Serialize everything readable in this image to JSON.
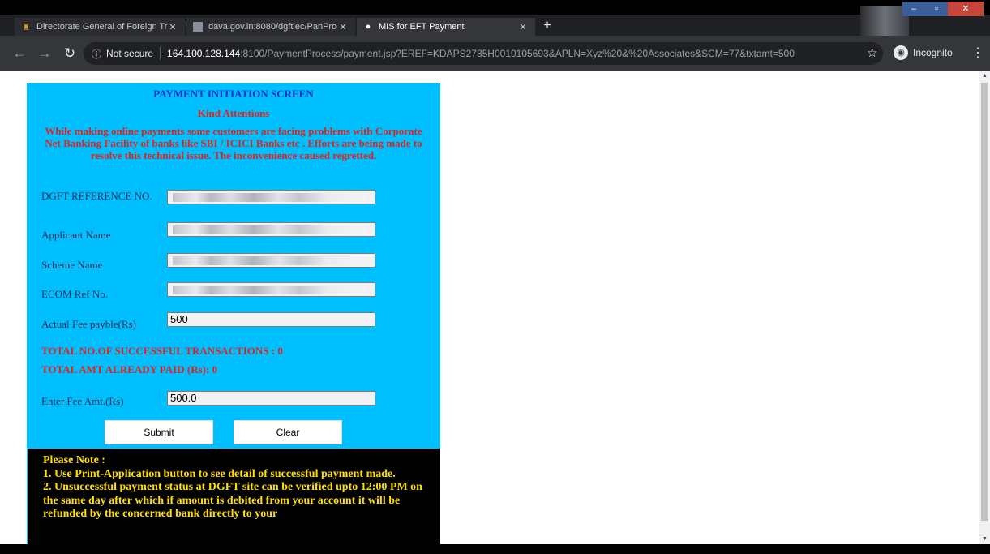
{
  "browser": {
    "tabs": [
      {
        "title": "Directorate General of Foreign Tr",
        "favicon": "emblem-icon",
        "active": false
      },
      {
        "title": "dava.gov.in:8080/dgftiec/PanProc",
        "favicon": "page-icon",
        "active": false
      },
      {
        "title": "MIS for EFT Payment",
        "favicon": "globe-icon",
        "active": true
      }
    ],
    "new_tab_symbol": "+",
    "security_label": "Not secure",
    "url_host": "164.100.128.144",
    "url_rest": ":8100/PaymentProcess/payment.jsp?EREF=KDAPS2735H0010105693&APLN=Xyz%20&%20Associates&SCM=77&txtamt=500",
    "profile_label": "Incognito"
  },
  "page": {
    "title": "PAYMENT INITIATION SCREEN",
    "attention_heading": "Kind Attentions",
    "attention_text": "While making online payments some customers are facing problems with Corporate Net Banking Facility of banks like SBI / ICICI Banks etc . Efforts are being made to resolve this technical issue. The inconvenience caused regretted.",
    "fields": {
      "dgft_ref_label": "DGFT REFERENCE NO.",
      "applicant_label": "Applicant Name",
      "scheme_label": "Scheme Name",
      "ecom_label": "ECOM Ref No.",
      "fee_label": "Actual Fee payble(Rs)",
      "fee_value": "500",
      "enter_fee_label": "Enter Fee Amt.(Rs)",
      "enter_fee_value": "500.0"
    },
    "total_transactions": "TOTAL NO.OF SUCCESSFUL TRANSACTIONS : 0",
    "total_paid": "TOTAL AMT ALREADY PAID (Rs): 0",
    "submit_label": "Submit",
    "clear_label": "Clear",
    "note": {
      "heading": "Please Note :",
      "line1": "1. Use Print-Application button to see detail of successful payment made.",
      "line2": "2. Unsuccessful payment status at DGFT site can be verified upto 12:00 PM on the same day after which if amount is debited from your account it will be refunded by the concerned bank directly to your"
    }
  },
  "colors": {
    "panel_bg": "#00bfff",
    "title_blue": "#0033cc",
    "alert_red": "#e0241b",
    "note_yellow": "#ffde00"
  }
}
